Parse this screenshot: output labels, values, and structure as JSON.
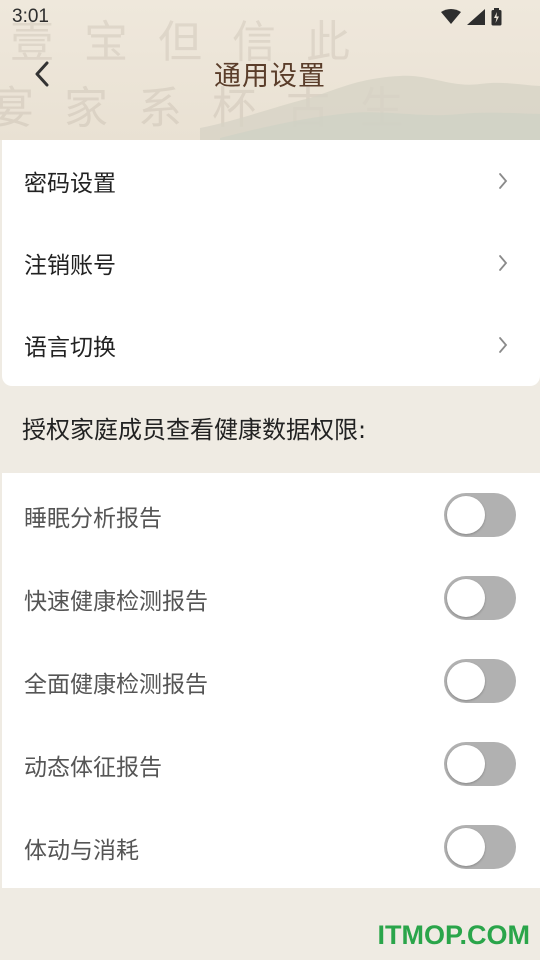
{
  "status_bar": {
    "time": "3:01"
  },
  "header": {
    "title": "通用设置",
    "back_icon": "chevron-left-icon"
  },
  "settings": [
    {
      "label": "密码设置",
      "icon": "chevron-right-icon"
    },
    {
      "label": "注销账号",
      "icon": "chevron-right-icon"
    },
    {
      "label": "语言切换",
      "icon": "chevron-right-icon"
    }
  ],
  "permissions": {
    "title": "授权家庭成员查看健康数据权限:",
    "items": [
      {
        "label": "睡眠分析报告",
        "enabled": false
      },
      {
        "label": "快速健康检测报告",
        "enabled": false
      },
      {
        "label": "全面健康检测报告",
        "enabled": false
      },
      {
        "label": "动态体征报告",
        "enabled": false
      },
      {
        "label": "体动与消耗",
        "enabled": false
      }
    ]
  },
  "watermark": "ITMOP.COM",
  "colors": {
    "background": "#efebe3",
    "title": "#5a3d2a",
    "toggle_off": "#b1b1b1",
    "watermark": "#2aa54a"
  }
}
